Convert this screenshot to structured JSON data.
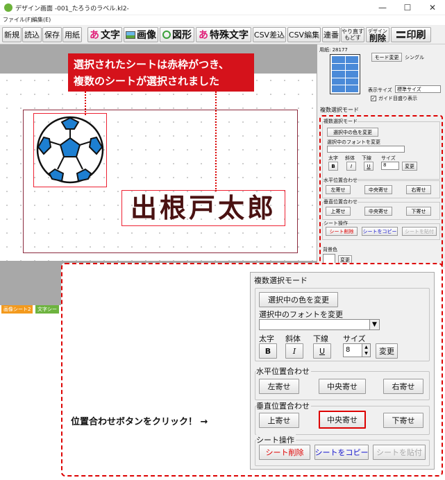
{
  "window": {
    "title": "デザイン画面 -001_たろうのラベル.kl2-",
    "menu": [
      "ファイル(F)",
      "編集(E)"
    ],
    "controls": [
      "—",
      "☐",
      "✕"
    ]
  },
  "toolbar": {
    "new": "新規",
    "open": "読込",
    "save": "保存",
    "paper": "用紙",
    "text": "文字",
    "text_icon": "あ",
    "image": "画像",
    "shape": "図形",
    "special_text": "特殊文字",
    "csv_insert": "CSV差込",
    "csv_edit": "CSV編集",
    "series": "連番",
    "redo": "やり直す",
    "undo": "もどす",
    "design_top": "デザイン",
    "delete": "削除",
    "print": "印刷"
  },
  "canvas": {
    "callout_line1": "選択されたシートは赤枠がつき、",
    "callout_line2": "複数のシートが選択されました",
    "name_text": "出根戸太郎",
    "tabs": [
      "画像シート2",
      "文字シー"
    ]
  },
  "side_panel": {
    "paper_label": "用紙: 28177",
    "mode_change": "モード変更",
    "mode_value": "シングル",
    "display_size_label": "表示サイズ",
    "display_size_value": "標準サイズ",
    "guide_checkbox": "ガイド目盛り表示",
    "multi_header": "複数選択モード",
    "multi_group": "複数選択モード",
    "change_color": "選択中の色を変更",
    "change_font": "選択中のフォントを変更",
    "bold": "太字",
    "italic": "斜体",
    "underline": "下線",
    "size": "サイズ",
    "bold_btn": "B",
    "italic_btn": "I",
    "underline_btn": "U",
    "size_value": "8",
    "change_btn": "変更",
    "h_align": "水平位置合わせ",
    "left": "左寄せ",
    "center": "中央寄せ",
    "right": "右寄せ",
    "v_align": "垂直位置合わせ",
    "top": "上寄せ",
    "middle": "中央寄せ",
    "bottom": "下寄せ",
    "sheet_ops": "シート操作",
    "sheet_delete": "シート削除",
    "sheet_copy": "シートをコピー",
    "sheet_paste": "シートを貼付",
    "bg_color": "背景色",
    "bg_change": "変更"
  },
  "zoom": {
    "mode": "複数選択モード",
    "change_color": "選択中の色を変更",
    "change_font": "選択中のフォントを変更",
    "bold": "太字",
    "italic": "斜体",
    "underline": "下線",
    "size": "サイズ",
    "bold_btn": "B",
    "italic_btn": "I",
    "underline_btn": "U",
    "size_value": "8",
    "change_btn": "変更",
    "h_align": "水平位置合わせ",
    "left": "左寄せ",
    "center": "中央寄せ",
    "right": "右寄せ",
    "v_align": "垂直位置合わせ",
    "top": "上寄せ",
    "middle": "中央寄せ",
    "bottom": "下寄せ",
    "sheet_ops": "シート操作",
    "sheet_delete": "シート削除",
    "sheet_copy": "シートをコピー",
    "sheet_paste": "シートを貼付",
    "instruction": "位置合わせボタンをクリック！ →"
  },
  "colors": {
    "accent_red": "#d5121b",
    "name_color": "#4a1212",
    "tab_orange": "#f39a1e",
    "tab_green": "#6db33f"
  }
}
